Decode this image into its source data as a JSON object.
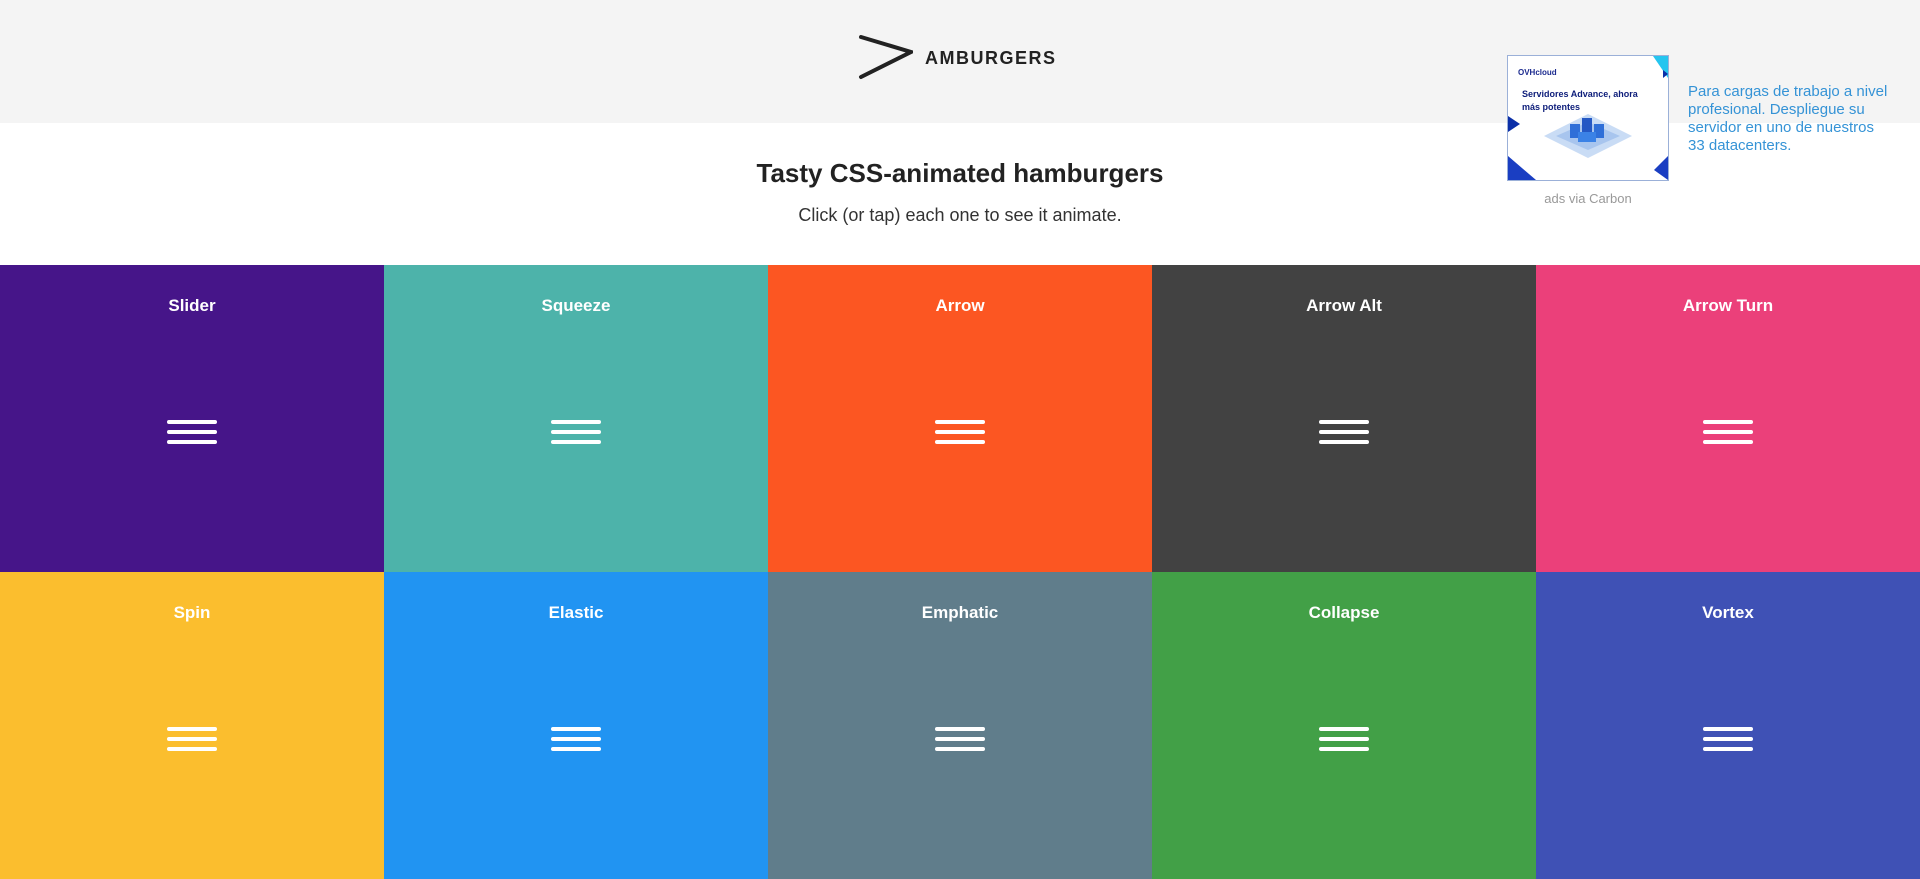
{
  "header": {
    "logo_text": "AMBURGERS"
  },
  "intro": {
    "title": "Tasty CSS-animated hamburgers",
    "subtitle": "Click (or tap) each one to see it animate."
  },
  "ad": {
    "brand": "OVHcloud",
    "image_headline": "Servidores Advance, ahora más potentes",
    "text": "Para cargas de trabajo a nivel profesional. Despliegue su servidor en uno de nuestros 33 datacenters.",
    "via": "ads via Carbon"
  },
  "colors": {
    "header_bg": "#f4f4f4",
    "slider": "#461589",
    "squeeze": "#4db3aa",
    "arrow": "#fc5622",
    "arrow_alt": "#424242",
    "arrow_turn": "#eb407a",
    "spin": "#fbbe2e",
    "elastic": "#2194f2",
    "emphatic": "#607d8b",
    "collapse": "#42a047",
    "vortex": "#3f51b5",
    "ad_link": "#3593d6"
  },
  "hamburgers": [
    {
      "label": "Slider",
      "color": "#461589",
      "icon": "hamburger-icon"
    },
    {
      "label": "Squeeze",
      "color": "#4db3aa",
      "icon": "hamburger-icon"
    },
    {
      "label": "Arrow",
      "color": "#fc5622",
      "icon": "hamburger-icon"
    },
    {
      "label": "Arrow Alt",
      "color": "#424242",
      "icon": "hamburger-icon"
    },
    {
      "label": "Arrow Turn",
      "color": "#eb407a",
      "icon": "hamburger-icon"
    },
    {
      "label": "Spin",
      "color": "#fbbe2e",
      "icon": "hamburger-icon"
    },
    {
      "label": "Elastic",
      "color": "#2194f2",
      "icon": "hamburger-icon"
    },
    {
      "label": "Emphatic",
      "color": "#607d8b",
      "icon": "hamburger-icon"
    },
    {
      "label": "Collapse",
      "color": "#42a047",
      "icon": "hamburger-icon"
    },
    {
      "label": "Vortex",
      "color": "#3f51b5",
      "icon": "hamburger-icon"
    }
  ]
}
